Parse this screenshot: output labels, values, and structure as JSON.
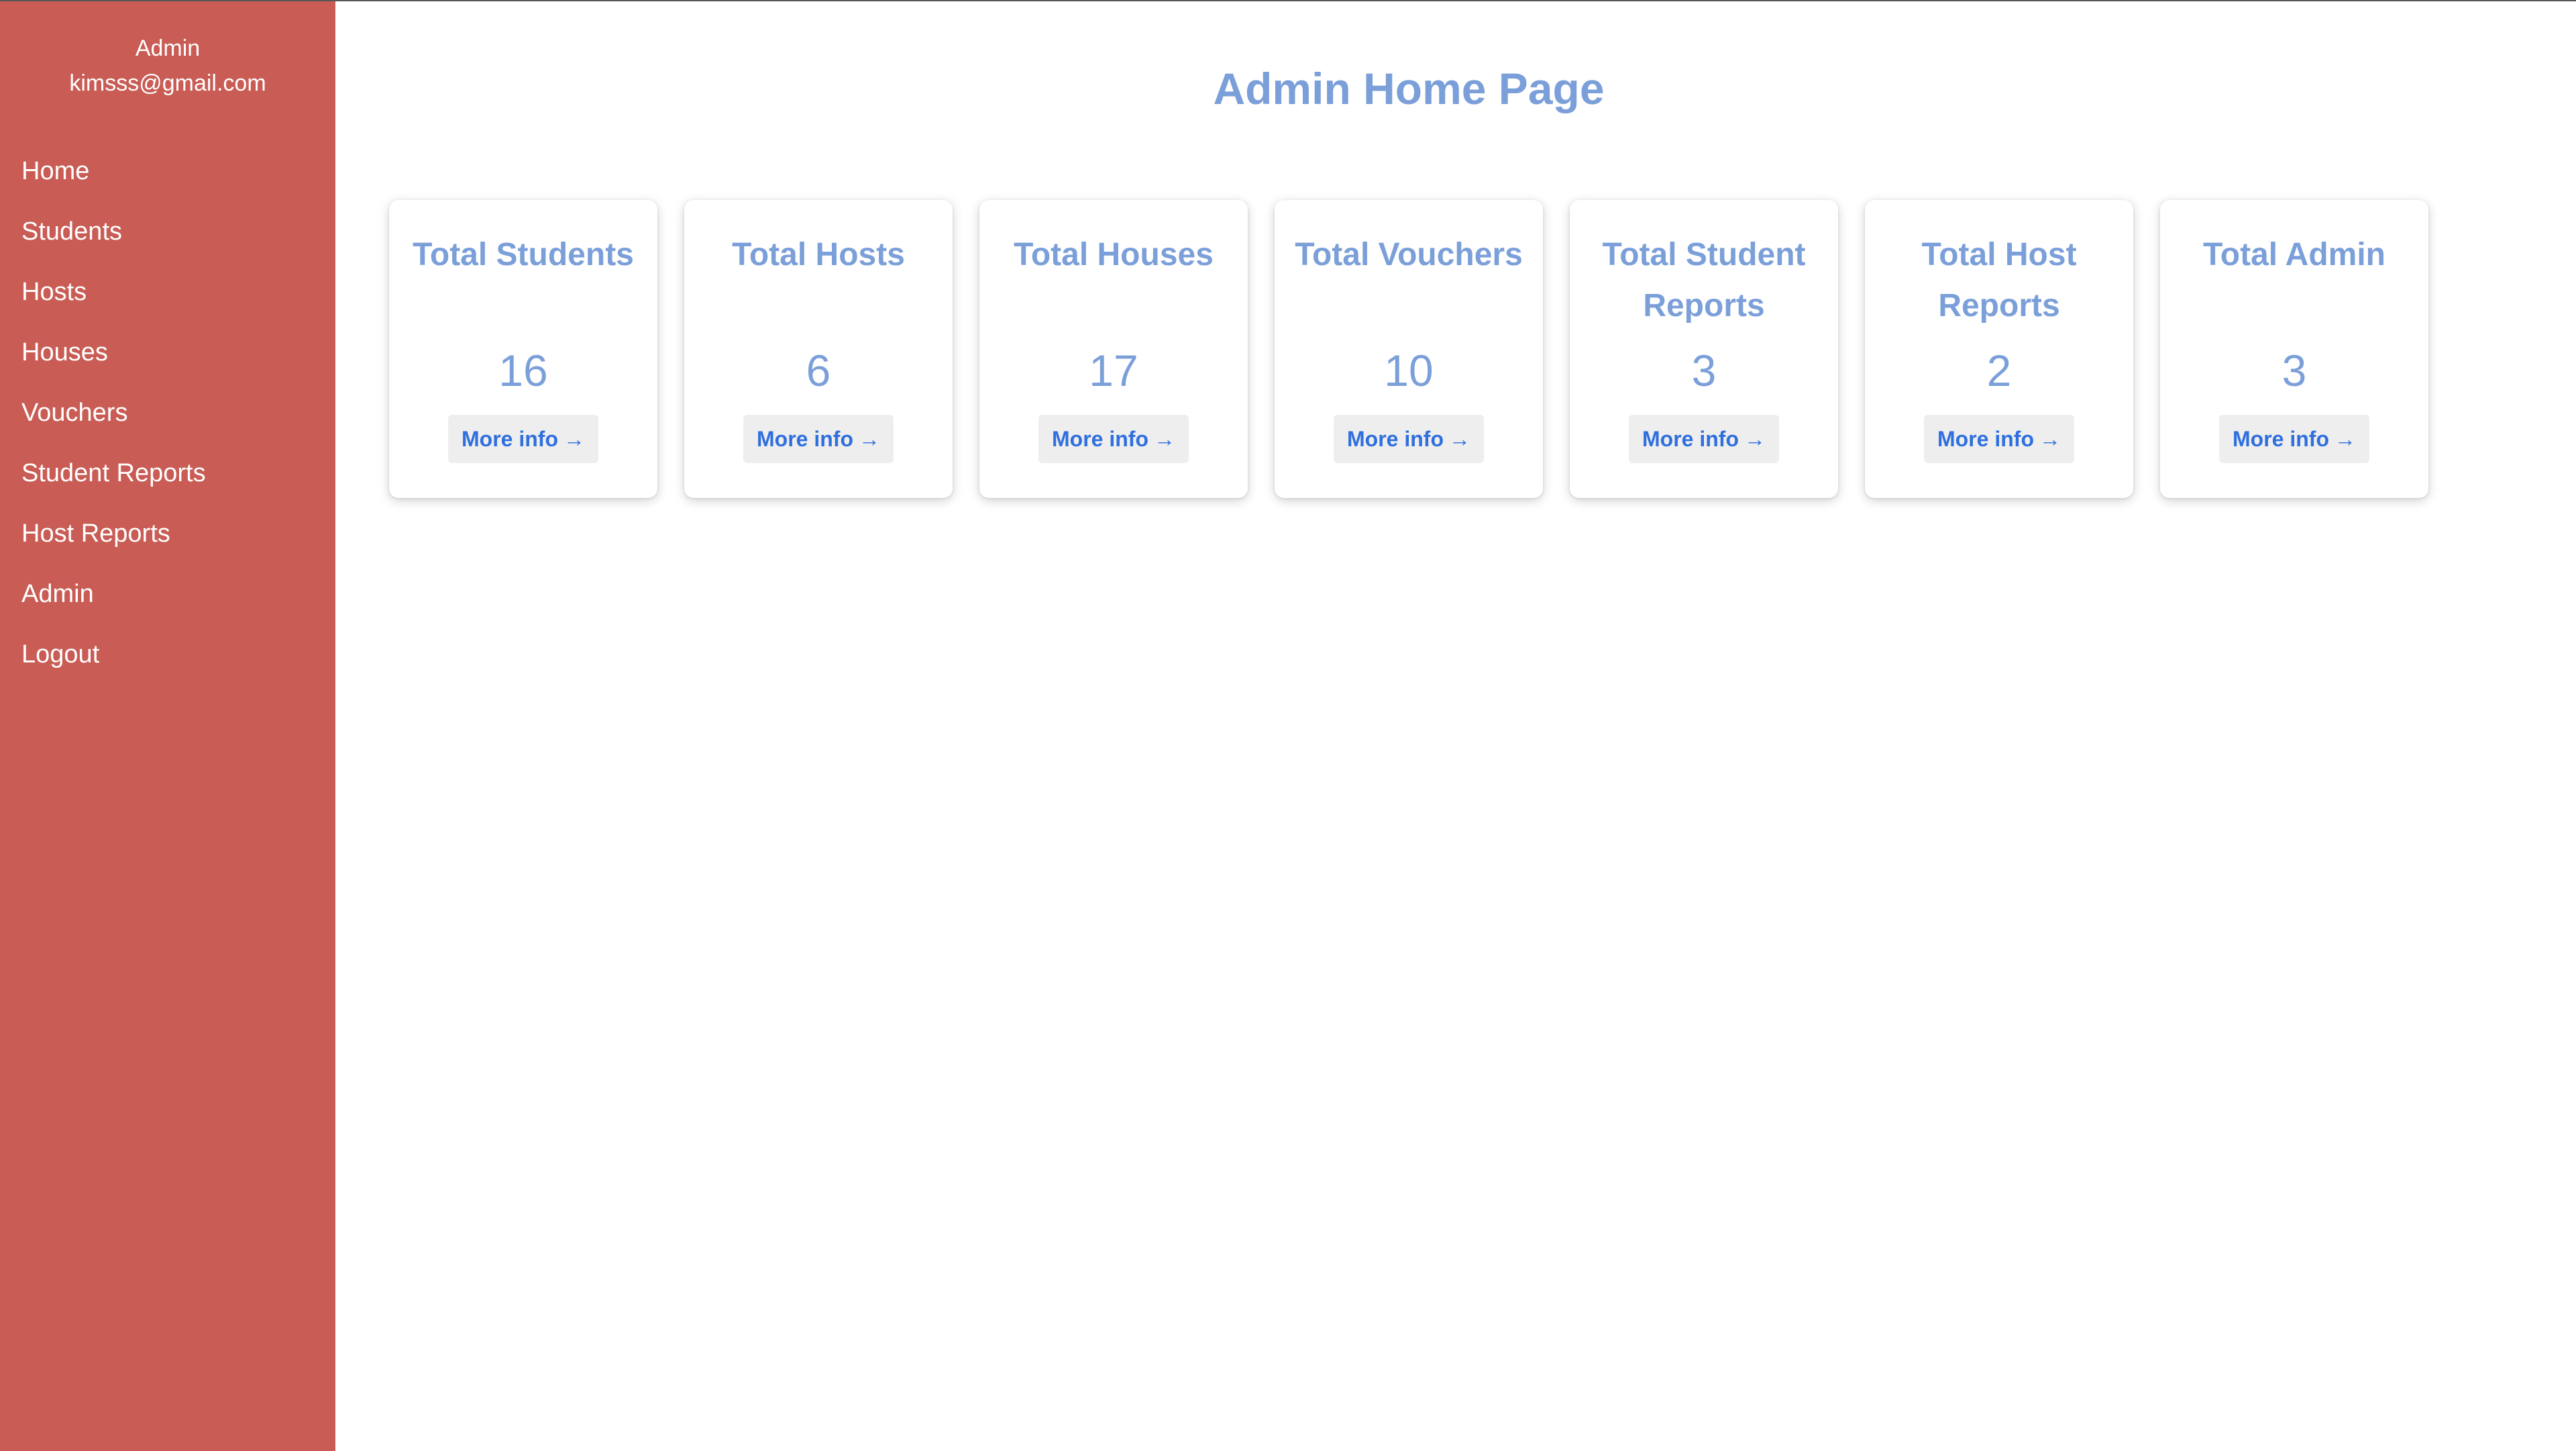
{
  "sidebar": {
    "user": {
      "role": "Admin",
      "email": "kimsss@gmail.com"
    },
    "items": [
      {
        "label": "Home"
      },
      {
        "label": "Students"
      },
      {
        "label": "Hosts"
      },
      {
        "label": "Houses"
      },
      {
        "label": "Vouchers"
      },
      {
        "label": "Student Reports"
      },
      {
        "label": "Host Reports"
      },
      {
        "label": "Admin"
      },
      {
        "label": "Logout"
      }
    ]
  },
  "main": {
    "title": "Admin Home Page",
    "cards": [
      {
        "title": "Total Students",
        "value": "16",
        "button": "More info",
        "arrow": "→"
      },
      {
        "title": "Total Hosts",
        "value": "6",
        "button": "More info",
        "arrow": "→"
      },
      {
        "title": "Total Houses",
        "value": "17",
        "button": "More info",
        "arrow": "→"
      },
      {
        "title": "Total Vouchers",
        "value": "10",
        "button": "More info",
        "arrow": "→"
      },
      {
        "title": "Total Student Reports",
        "value": "3",
        "button": "More info",
        "arrow": "→"
      },
      {
        "title": "Total Host Reports",
        "value": "2",
        "button": "More info",
        "arrow": "→"
      },
      {
        "title": "Total Admin",
        "value": "3",
        "button": "More info",
        "arrow": "→"
      }
    ]
  },
  "colors": {
    "sidebar_bg": "#c95c54",
    "accent": "#7b9fd9",
    "link": "#2f6fde",
    "button_bg": "#eeeeee"
  },
  "icons": {
    "more_info": "arrow-right-icon"
  }
}
